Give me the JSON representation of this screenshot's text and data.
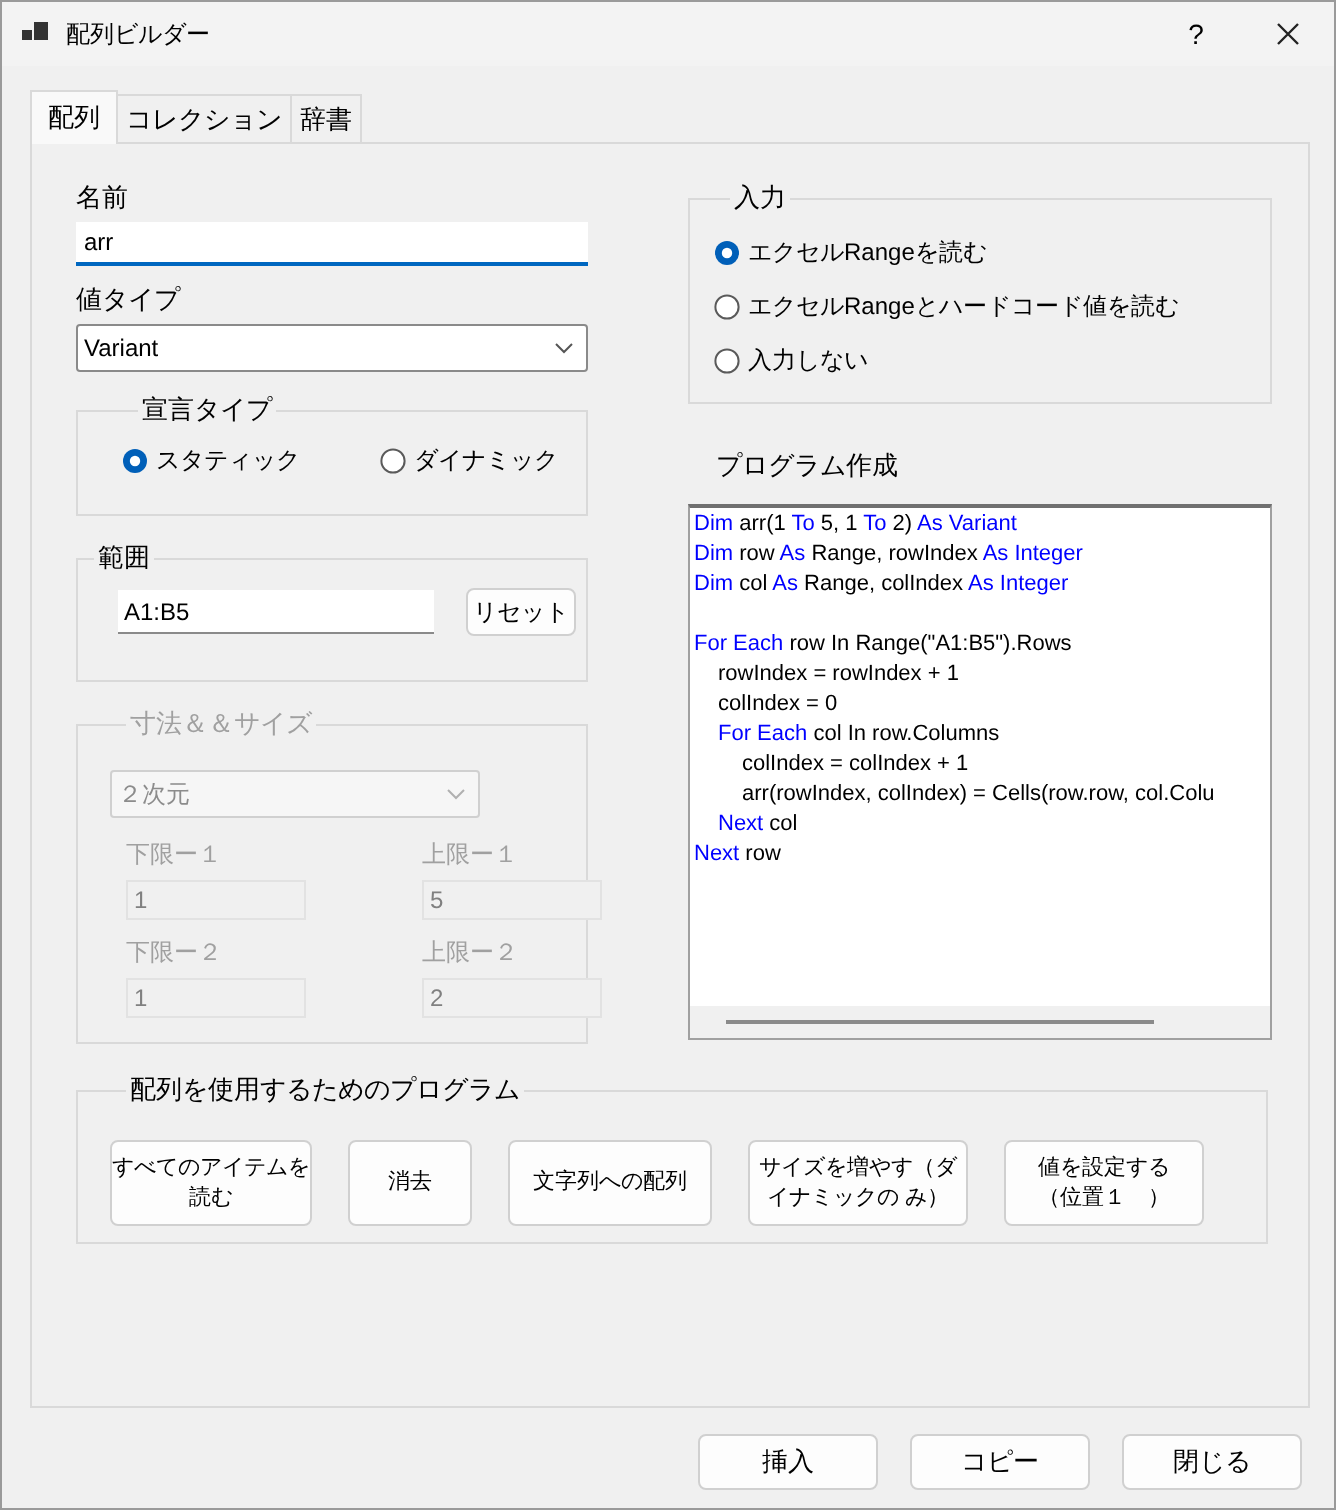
{
  "window": {
    "title": "配列ビルダー",
    "help": "?"
  },
  "tabs": [
    {
      "label": "配列",
      "selected": true
    },
    {
      "label": "コレクション",
      "selected": false
    },
    {
      "label": "辞書",
      "selected": false
    }
  ],
  "name": {
    "label": "名前",
    "value": "arr"
  },
  "value_type": {
    "label": "値タイプ",
    "value": "Variant"
  },
  "declaration": {
    "title": "宣言タイプ",
    "options": [
      {
        "label": "スタティック",
        "selected": true
      },
      {
        "label": "ダイナミック",
        "selected": false
      }
    ]
  },
  "range": {
    "title": "範囲",
    "value": "A1:B5",
    "button": "リセット"
  },
  "dimensions": {
    "title": "寸法＆＆サイズ",
    "disabled": true,
    "select": "２次元",
    "fields": [
      {
        "label": "下限ー１",
        "value": "1"
      },
      {
        "label": "上限ー１",
        "value": "5"
      },
      {
        "label": "下限ー２",
        "value": "1"
      },
      {
        "label": "上限ー２",
        "value": "2"
      }
    ]
  },
  "input": {
    "title": "入力",
    "options": [
      {
        "label": "エクセルRangeを読む",
        "selected": true
      },
      {
        "label": "エクセルRangeとハードコード値を読む",
        "selected": false
      },
      {
        "label": "入力しない",
        "selected": false
      }
    ]
  },
  "program": {
    "title": "プログラム作成",
    "lines": [
      {
        "segments": [
          {
            "text": "Dim",
            "kind": "keyword"
          },
          {
            "text": " arr(1 ",
            "kind": "plain"
          },
          {
            "text": "To",
            "kind": "keyword"
          },
          {
            "text": " 5, 1 ",
            "kind": "plain"
          },
          {
            "text": "To",
            "kind": "keyword"
          },
          {
            "text": " 2) ",
            "kind": "plain"
          },
          {
            "text": "As Variant",
            "kind": "keyword"
          }
        ]
      },
      {
        "segments": [
          {
            "text": "Dim",
            "kind": "keyword"
          },
          {
            "text": " row ",
            "kind": "plain"
          },
          {
            "text": "As",
            "kind": "keyword"
          },
          {
            "text": " Range, rowIndex ",
            "kind": "plain"
          },
          {
            "text": "As Integer",
            "kind": "keyword"
          }
        ]
      },
      {
        "segments": [
          {
            "text": "Dim",
            "kind": "keyword"
          },
          {
            "text": " col ",
            "kind": "plain"
          },
          {
            "text": "As",
            "kind": "keyword"
          },
          {
            "text": " Range, colIndex ",
            "kind": "plain"
          },
          {
            "text": "As Integer",
            "kind": "keyword"
          }
        ]
      },
      {
        "kind": "blank"
      },
      {
        "segments": [
          {
            "text": "For Each",
            "kind": "keyword"
          },
          {
            "text": " row In Range(\"A1:B5\").Rows",
            "kind": "plain"
          }
        ],
        "children": [
          {
            "segments": [
              {
                "text": "rowIndex = rowIndex + 1",
                "kind": "plain"
              }
            ]
          },
          {
            "segments": [
              {
                "text": "colIndex = 0",
                "kind": "plain"
              }
            ]
          },
          {
            "segments": [
              {
                "text": "For Each",
                "kind": "keyword"
              },
              {
                "text": " col In row.Columns",
                "kind": "plain"
              }
            ],
            "children": [
              {
                "segments": [
                  {
                    "text": "colIndex = colIndex + 1",
                    "kind": "plain"
                  }
                ]
              },
              {
                "segments": [
                  {
                    "text": "arr(rowIndex, colIndex) = Cells(row.row, col.Colu",
                    "kind": "plain"
                  }
                ]
              }
            ]
          },
          {
            "segments": [
              {
                "text": "Next",
                "kind": "keyword"
              },
              {
                "text": " col",
                "kind": "plain"
              }
            ]
          }
        ]
      },
      {
        "segments": [
          {
            "text": "Next",
            "kind": "keyword"
          },
          {
            "text": " row",
            "kind": "plain"
          }
        ]
      }
    ]
  },
  "usage": {
    "title": "配列を使用するためのプログラム",
    "buttons": [
      {
        "lines": [
          "すべてのアイテムを",
          "読む"
        ]
      },
      {
        "lines": [
          "消去"
        ]
      },
      {
        "lines": [
          "文字列への配列"
        ]
      },
      {
        "lines": [
          "サイズを増やす（ダ",
          "イナミックの み）"
        ]
      },
      {
        "lines": [
          "値を設定する",
          "（位置１　）"
        ]
      }
    ]
  },
  "footer_buttons": [
    "挿入",
    "コピー",
    "閉じる"
  ]
}
